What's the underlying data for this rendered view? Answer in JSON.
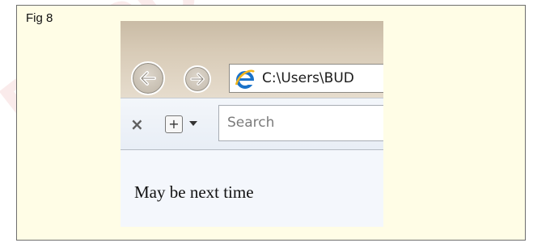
{
  "figure": {
    "label": "Fig 8",
    "watermark": "REPUBLISHED"
  },
  "browser": {
    "address": "C:\\Users\\BUD",
    "search": {
      "placeholder": "Search",
      "value": ""
    },
    "close_tab_glyph": "×",
    "new_tab_glyph": "+",
    "icons": [
      "back-arrow-icon",
      "forward-arrow-icon",
      "ie-logo-icon",
      "close-icon",
      "plus-icon",
      "chevron-down-icon"
    ]
  },
  "page": {
    "text": "May be next time"
  },
  "colors": {
    "figure_background": "#fffde6",
    "nav_bar": "#d8cbb7",
    "content_background": "#f4f7fc",
    "ie_blue": "#1a72c9"
  }
}
